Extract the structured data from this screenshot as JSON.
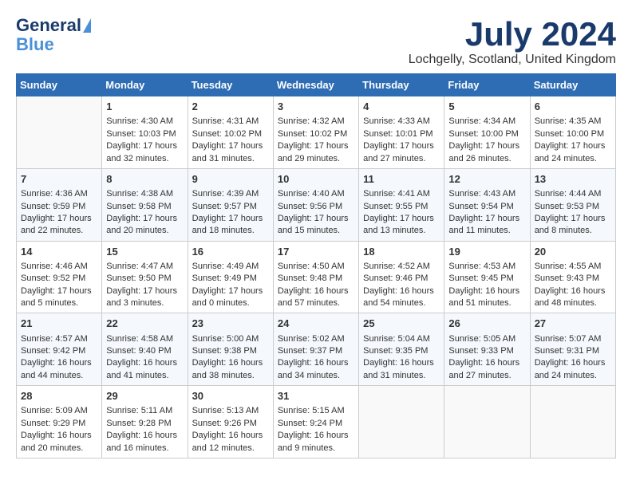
{
  "header": {
    "logo_line1": "General",
    "logo_line2": "Blue",
    "month_title": "July 2024",
    "location": "Lochgelly, Scotland, United Kingdom"
  },
  "days_of_week": [
    "Sunday",
    "Monday",
    "Tuesday",
    "Wednesday",
    "Thursday",
    "Friday",
    "Saturday"
  ],
  "weeks": [
    [
      {
        "num": "",
        "content": ""
      },
      {
        "num": "1",
        "content": "Sunrise: 4:30 AM\nSunset: 10:03 PM\nDaylight: 17 hours\nand 32 minutes."
      },
      {
        "num": "2",
        "content": "Sunrise: 4:31 AM\nSunset: 10:02 PM\nDaylight: 17 hours\nand 31 minutes."
      },
      {
        "num": "3",
        "content": "Sunrise: 4:32 AM\nSunset: 10:02 PM\nDaylight: 17 hours\nand 29 minutes."
      },
      {
        "num": "4",
        "content": "Sunrise: 4:33 AM\nSunset: 10:01 PM\nDaylight: 17 hours\nand 27 minutes."
      },
      {
        "num": "5",
        "content": "Sunrise: 4:34 AM\nSunset: 10:00 PM\nDaylight: 17 hours\nand 26 minutes."
      },
      {
        "num": "6",
        "content": "Sunrise: 4:35 AM\nSunset: 10:00 PM\nDaylight: 17 hours\nand 24 minutes."
      }
    ],
    [
      {
        "num": "7",
        "content": "Sunrise: 4:36 AM\nSunset: 9:59 PM\nDaylight: 17 hours\nand 22 minutes."
      },
      {
        "num": "8",
        "content": "Sunrise: 4:38 AM\nSunset: 9:58 PM\nDaylight: 17 hours\nand 20 minutes."
      },
      {
        "num": "9",
        "content": "Sunrise: 4:39 AM\nSunset: 9:57 PM\nDaylight: 17 hours\nand 18 minutes."
      },
      {
        "num": "10",
        "content": "Sunrise: 4:40 AM\nSunset: 9:56 PM\nDaylight: 17 hours\nand 15 minutes."
      },
      {
        "num": "11",
        "content": "Sunrise: 4:41 AM\nSunset: 9:55 PM\nDaylight: 17 hours\nand 13 minutes."
      },
      {
        "num": "12",
        "content": "Sunrise: 4:43 AM\nSunset: 9:54 PM\nDaylight: 17 hours\nand 11 minutes."
      },
      {
        "num": "13",
        "content": "Sunrise: 4:44 AM\nSunset: 9:53 PM\nDaylight: 17 hours\nand 8 minutes."
      }
    ],
    [
      {
        "num": "14",
        "content": "Sunrise: 4:46 AM\nSunset: 9:52 PM\nDaylight: 17 hours\nand 5 minutes."
      },
      {
        "num": "15",
        "content": "Sunrise: 4:47 AM\nSunset: 9:50 PM\nDaylight: 17 hours\nand 3 minutes."
      },
      {
        "num": "16",
        "content": "Sunrise: 4:49 AM\nSunset: 9:49 PM\nDaylight: 17 hours\nand 0 minutes."
      },
      {
        "num": "17",
        "content": "Sunrise: 4:50 AM\nSunset: 9:48 PM\nDaylight: 16 hours\nand 57 minutes."
      },
      {
        "num": "18",
        "content": "Sunrise: 4:52 AM\nSunset: 9:46 PM\nDaylight: 16 hours\nand 54 minutes."
      },
      {
        "num": "19",
        "content": "Sunrise: 4:53 AM\nSunset: 9:45 PM\nDaylight: 16 hours\nand 51 minutes."
      },
      {
        "num": "20",
        "content": "Sunrise: 4:55 AM\nSunset: 9:43 PM\nDaylight: 16 hours\nand 48 minutes."
      }
    ],
    [
      {
        "num": "21",
        "content": "Sunrise: 4:57 AM\nSunset: 9:42 PM\nDaylight: 16 hours\nand 44 minutes."
      },
      {
        "num": "22",
        "content": "Sunrise: 4:58 AM\nSunset: 9:40 PM\nDaylight: 16 hours\nand 41 minutes."
      },
      {
        "num": "23",
        "content": "Sunrise: 5:00 AM\nSunset: 9:38 PM\nDaylight: 16 hours\nand 38 minutes."
      },
      {
        "num": "24",
        "content": "Sunrise: 5:02 AM\nSunset: 9:37 PM\nDaylight: 16 hours\nand 34 minutes."
      },
      {
        "num": "25",
        "content": "Sunrise: 5:04 AM\nSunset: 9:35 PM\nDaylight: 16 hours\nand 31 minutes."
      },
      {
        "num": "26",
        "content": "Sunrise: 5:05 AM\nSunset: 9:33 PM\nDaylight: 16 hours\nand 27 minutes."
      },
      {
        "num": "27",
        "content": "Sunrise: 5:07 AM\nSunset: 9:31 PM\nDaylight: 16 hours\nand 24 minutes."
      }
    ],
    [
      {
        "num": "28",
        "content": "Sunrise: 5:09 AM\nSunset: 9:29 PM\nDaylight: 16 hours\nand 20 minutes."
      },
      {
        "num": "29",
        "content": "Sunrise: 5:11 AM\nSunset: 9:28 PM\nDaylight: 16 hours\nand 16 minutes."
      },
      {
        "num": "30",
        "content": "Sunrise: 5:13 AM\nSunset: 9:26 PM\nDaylight: 16 hours\nand 12 minutes."
      },
      {
        "num": "31",
        "content": "Sunrise: 5:15 AM\nSunset: 9:24 PM\nDaylight: 16 hours\nand 9 minutes."
      },
      {
        "num": "",
        "content": ""
      },
      {
        "num": "",
        "content": ""
      },
      {
        "num": "",
        "content": ""
      }
    ]
  ]
}
